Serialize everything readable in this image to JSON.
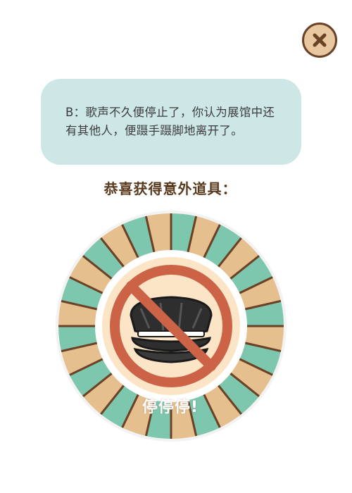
{
  "close_button": {
    "icon": "close-icon",
    "accent": "#6b4226"
  },
  "dialog": {
    "text": "B：歌声不久便停止了，你认为展馆中还有其他人，便蹑手蹑脚地离开了。"
  },
  "reward": {
    "title": "恭喜获得意外道具：",
    "item_icon": "black-cap-prohibited-icon",
    "item_name": "停停停!"
  },
  "colors": {
    "ray_teal": "#7dc7ae",
    "ray_tan": "#e6bf8f",
    "ring_stroke": "#6b4226",
    "prohibit_red": "#cc6347",
    "inner_bg": "#fbe5c6"
  }
}
